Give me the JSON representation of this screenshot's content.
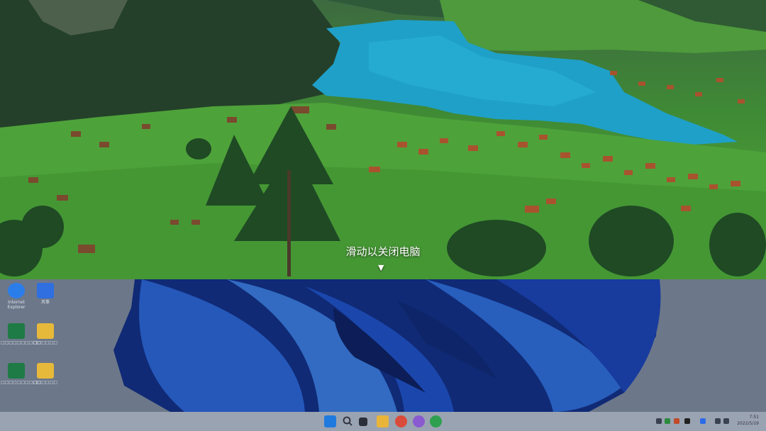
{
  "slide": {
    "hint": "滑动以关闭电脑",
    "arrow": "▼"
  },
  "desktop_icons": [
    {
      "name": "internet-explorer-icon",
      "label": "Internet Explorer",
      "color": "#2b7de9"
    },
    {
      "name": "kite-app-icon",
      "label": "风筝",
      "color": "#2f6fe0"
    },
    {
      "name": "excel-file-icon",
      "label": "□□□□□□□□□□",
      "color": "#1e7b45"
    },
    {
      "name": "folder-icon",
      "label": "□□□□□□",
      "color": "#e7b93a"
    },
    {
      "name": "excel-file-icon",
      "label": "□□□□□□□□□□",
      "color": "#1e7b45"
    },
    {
      "name": "folder-icon",
      "label": "□□□□□□",
      "color": "#e7b93a"
    }
  ],
  "taskbar": {
    "apps": [
      {
        "name": "start-icon",
        "color": "#1f7ae0"
      },
      {
        "name": "search-icon",
        "color": "#2a2f3a"
      },
      {
        "name": "task-view-icon",
        "color": "#2a2f3a"
      },
      {
        "name": "file-explorer-icon",
        "color": "#e8b53a"
      },
      {
        "name": "chrome-icon",
        "color": "#d94b3a"
      },
      {
        "name": "app-icon",
        "color": "#8a5ad0"
      },
      {
        "name": "app-icon",
        "color": "#2ea04f"
      }
    ],
    "clock": {
      "time": "7:51",
      "date": "2022/5/19"
    }
  },
  "colors": {
    "lake": "#1fa0c8",
    "grass": "#4a9a37",
    "wallpaper_blue": "#1b4fd6",
    "taskbar": "#9aa3b1"
  }
}
